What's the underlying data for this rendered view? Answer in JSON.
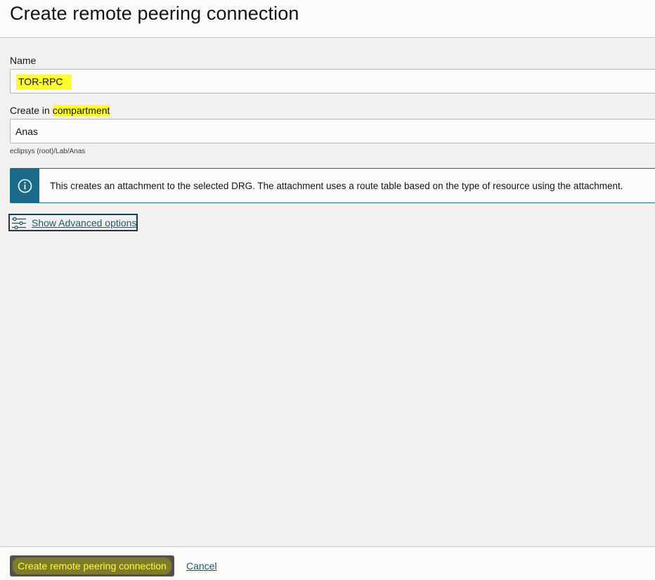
{
  "header": {
    "title": "Create remote peering connection"
  },
  "form": {
    "name_label": "Name",
    "name_value": "TOR-RPC",
    "compartment_label_prefix": "Create in",
    "compartment_label_highlight": "compartment",
    "compartment_value": "Anas",
    "compartment_path": "eclipsys (root)/Lab/Anas"
  },
  "info": {
    "icon": "info-icon",
    "text": "This creates an attachment to the selected DRG. The attachment uses a route table based on the type of resource using the attachment."
  },
  "advanced": {
    "icon": "sliders-icon",
    "label": "Show Advanced options"
  },
  "footer": {
    "create_label": "Create remote peering connection",
    "cancel_label": "Cancel"
  },
  "colors": {
    "highlight": "#ffff2e",
    "accent": "#1c6a8a",
    "primary_button": "#54504a"
  }
}
